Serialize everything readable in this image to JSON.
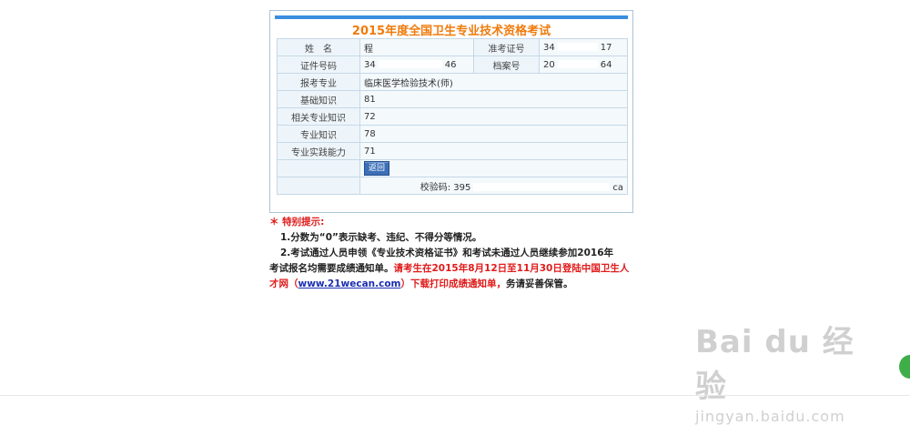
{
  "title": "2015年度全国卫生专业技术资格考试",
  "fields": {
    "name_label": "姓　名",
    "name_value": "程",
    "ticket_label": "准考证号",
    "ticket_prefix": "34",
    "ticket_suffix": "17",
    "id_label": "证件号码",
    "id_prefix": "34",
    "id_suffix": "46",
    "file_label": "档案号",
    "file_prefix": "20",
    "file_suffix": "64",
    "major_label": "报考专业",
    "major_value": "临床医学检验技术(师)",
    "basic_label": "基础知识",
    "basic_score": "81",
    "related_label": "相关专业知识",
    "related_score": "72",
    "professional_label": "专业知识",
    "professional_score": "78",
    "practice_label": "专业实践能力",
    "practice_score": "71"
  },
  "back_button": "返回",
  "checksum": {
    "label": "校验码:",
    "prefix": "395",
    "suffix": "ca"
  },
  "notice": {
    "header": "＊ 特别提示:",
    "item1": "1.分数为“0”表示缺考、违纪、不得分等情况。",
    "item2_part1": "2.考试通过人员申领《专业技术资格证书》和考试未通过人员继续参加2016年",
    "item2_part2": "考试报名均需要成绩通知单。",
    "item2_red": "请考生在2015年8月12日至11月30日登陆中国卫生人",
    "item2_part3": "才网（",
    "item2_link": "www.21wecan.com",
    "item2_part4": "）下载打印成绩通知单，",
    "item2_part5": "务请妥善保管。"
  },
  "watermark": {
    "logo": "Bai du 经验",
    "url": "jingyan.baidu.com"
  },
  "colors": {
    "title": "#f07b0c",
    "accent_bar": "#3a8ede",
    "notice_red": "#e01b1b",
    "link": "#1b2fb0"
  }
}
